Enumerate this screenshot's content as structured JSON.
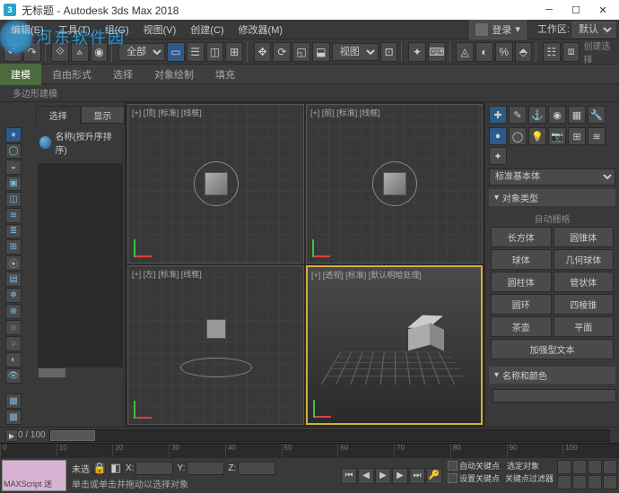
{
  "titlebar": {
    "icon": "3",
    "title": "无标题 - Autodesk 3ds Max 2018"
  },
  "watermark": "河东软件园",
  "menubar": {
    "items": [
      "编辑(E)",
      "工具(T)",
      "组(G)",
      "视图(V)",
      "创建(C)",
      "修改器(M)"
    ],
    "login": "登录",
    "workspace_label": "工作区:",
    "workspace_value": "默认"
  },
  "toolbar": {
    "dropdown1": "全部",
    "dropdown2": "视图",
    "create_label": "创建选择"
  },
  "ribbon": {
    "tabs": [
      "建模",
      "自由形式",
      "选择",
      "对象绘制",
      "填充"
    ],
    "subtab": "多边形建模"
  },
  "leftpanel": {
    "tabs": [
      "选择",
      "显示"
    ],
    "header": "名称(按升序排序)"
  },
  "viewports": {
    "top": "[+] [顶] [标准] [线框]",
    "front": "[+] [前] [标准] [线框]",
    "left": "[+] [左] [标准] [线框]",
    "persp": "[+] [透视] [标准] [默认明暗处理]"
  },
  "rightpanel": {
    "category": "标准基本体",
    "rollout_objtype": "对象类型",
    "autogrid": "自动栅格",
    "primitives": [
      "长方体",
      "圆锥体",
      "球体",
      "几何球体",
      "圆柱体",
      "管状体",
      "圆环",
      "四棱锥",
      "茶壶",
      "平面"
    ],
    "primitive_wide": "加强型文本",
    "rollout_name": "名称和颜色",
    "name_value": ""
  },
  "timeline": {
    "label": "0 / 100",
    "ticks": [
      "0",
      "10",
      "20",
      "30",
      "40",
      "50",
      "60",
      "70",
      "80",
      "90",
      "100"
    ]
  },
  "status": {
    "script": "MAXScript 迷",
    "none": "未选",
    "x": "X:",
    "y": "Y:",
    "z": "Z:",
    "prompt": "单击或单击并拖动以选择对象",
    "autokey": "自动关键点",
    "selected": "选定对象",
    "setkey": "设置关键点",
    "keyfilter": "关键点过滤器"
  }
}
